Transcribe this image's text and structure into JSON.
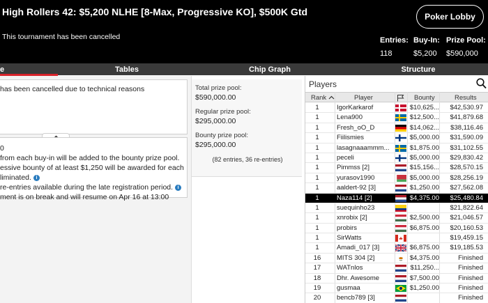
{
  "header": {
    "title": "High Rollers 42: $5,200 NLHE [8-Max, Progressive KO], $500K Gtd",
    "status": "This tournament has been cancelled",
    "lobby_button": "Poker Lobby",
    "stats": [
      {
        "label": "Entries:",
        "value": "118"
      },
      {
        "label": "Buy-In:",
        "value": "$5,200"
      },
      {
        "label": "Prize Pool:",
        "value": "$590,000"
      }
    ]
  },
  "tabs": [
    "e",
    "Tables",
    "Chip Graph",
    "Structure"
  ],
  "info": {
    "cancel_msg": "has been cancelled due to technical reasons",
    "line0": "0",
    "line1": "from each buy-in will be added to the bounty prize pool.",
    "line2": "essive bounty of at least $1,250 will be awarded for each",
    "line3": "liminated.",
    "line4": "re-entries available during the late registration period.",
    "line5": "ment is on break and will resume on Apr 16 at 13:00"
  },
  "prize": {
    "total_label": "Total prize pool:",
    "total_value": "$590,000.00",
    "regular_label": "Regular prize pool:",
    "regular_value": "$295,000.00",
    "bounty_label": "Bounty prize pool:",
    "bounty_value": "$295,000.00",
    "entries_note": "(82 entries, 36 re-entries)"
  },
  "players": {
    "title": "Players",
    "columns": {
      "rank": "Rank",
      "player": "Player",
      "bounty": "Bounty",
      "results": "Results"
    },
    "rows": [
      {
        "rank": "1",
        "player": "IgorKarkarof",
        "flag": "dk",
        "bounty": "$10,625...",
        "result": "$42,530.97"
      },
      {
        "rank": "1",
        "player": "Lena900",
        "flag": "se",
        "bounty": "$12,500...",
        "result": "$41,879.68"
      },
      {
        "rank": "1",
        "player": "Fresh_oO_D",
        "flag": "de",
        "bounty": "$14,062...",
        "result": "$38,116.46"
      },
      {
        "rank": "1",
        "player": "Fiilismies",
        "flag": "fi",
        "bounty": "$5,000.00",
        "result": "$31,590.09"
      },
      {
        "rank": "1",
        "player": "lasagnaaammm...",
        "flag": "se",
        "bounty": "$1,875.00",
        "result": "$31,102.55"
      },
      {
        "rank": "1",
        "player": "peceli",
        "flag": "fi",
        "bounty": "$5,000.00",
        "result": "$29,830.42"
      },
      {
        "rank": "1",
        "player": "Pimmss [2]",
        "flag": "nl",
        "bounty": "$15,156...",
        "result": "$28,570.15"
      },
      {
        "rank": "1",
        "player": "yurasov1990",
        "flag": "by",
        "bounty": "$5,000.00",
        "result": "$28,256.19"
      },
      {
        "rank": "1",
        "player": "aaldert-92 [3]",
        "flag": "nl",
        "bounty": "$1,250.00",
        "result": "$27,562.08"
      },
      {
        "rank": "1",
        "player": "Naza114 [2]",
        "flag": "nl",
        "bounty": "$4,375.00",
        "result": "$25,480.84",
        "selected": true
      },
      {
        "rank": "1",
        "player": "suequinho23",
        "flag": "co",
        "bounty": "",
        "result": "$21,822.64"
      },
      {
        "rank": "1",
        "player": "xnrobix [2]",
        "flag": "hu",
        "bounty": "$2,500.00",
        "result": "$21,046.57"
      },
      {
        "rank": "1",
        "player": "probirs",
        "flag": "hu",
        "bounty": "$6,875.00",
        "result": "$20,160.53"
      },
      {
        "rank": "1",
        "player": "SirWatts",
        "flag": "ca",
        "bounty": "",
        "result": "$19,459.15"
      },
      {
        "rank": "1",
        "player": "Amadi_017 [3]",
        "flag": "gb",
        "bounty": "$6,875.00",
        "result": "$19,185.53"
      },
      {
        "rank": "16",
        "player": "MITS 304 [2]",
        "flag": "cy",
        "bounty": "$4,375.00",
        "result": "Finished"
      },
      {
        "rank": "17",
        "player": "WATnlos",
        "flag": "nl",
        "bounty": "$11,250...",
        "result": "Finished"
      },
      {
        "rank": "18",
        "player": "Dhr. Awesome",
        "flag": "nl",
        "bounty": "$7,500.00",
        "result": "Finished"
      },
      {
        "rank": "19",
        "player": "gusmaa",
        "flag": "br",
        "bounty": "$1,250.00",
        "result": "Finished"
      },
      {
        "rank": "20",
        "player": "bencb789 [3]",
        "flag": "nl",
        "bounty": "",
        "result": "Finished"
      }
    ]
  }
}
